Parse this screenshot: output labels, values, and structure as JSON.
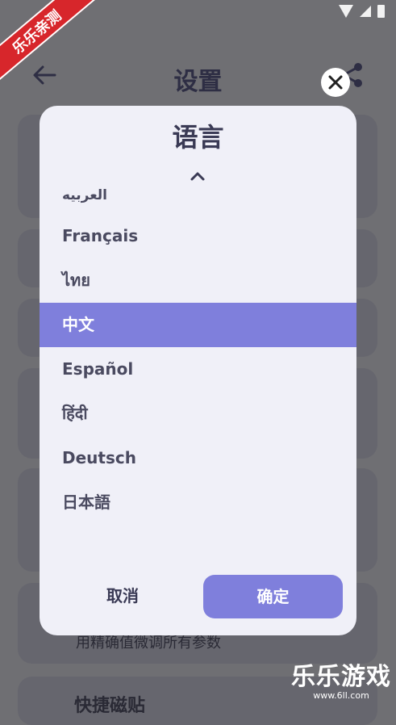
{
  "screen": {
    "title": "设置",
    "bg_hint_text": "用精确值微调所有参数",
    "bg_bottom_text": "快捷磁贴"
  },
  "dialog": {
    "title": "语言",
    "languages": [
      "العربيه",
      "Français",
      "ไทย",
      "中文",
      "Español",
      "हिंदी",
      "Deutsch",
      "日本語"
    ],
    "selected": "中文",
    "cancel_label": "取消",
    "confirm_label": "确定"
  },
  "watermark": {
    "ribbon": "乐乐亲测",
    "brand": "乐乐游戏",
    "url": "www.6ll.com"
  },
  "colors": {
    "accent": "#7f7fdc",
    "dialog_bg": "#f0f0f8",
    "text_dark": "#3a3a55"
  },
  "icons": [
    "back-arrow-icon",
    "share-icon",
    "close-icon",
    "chevron-up-icon",
    "wifi-icon",
    "signal-icon",
    "battery-icon"
  ]
}
